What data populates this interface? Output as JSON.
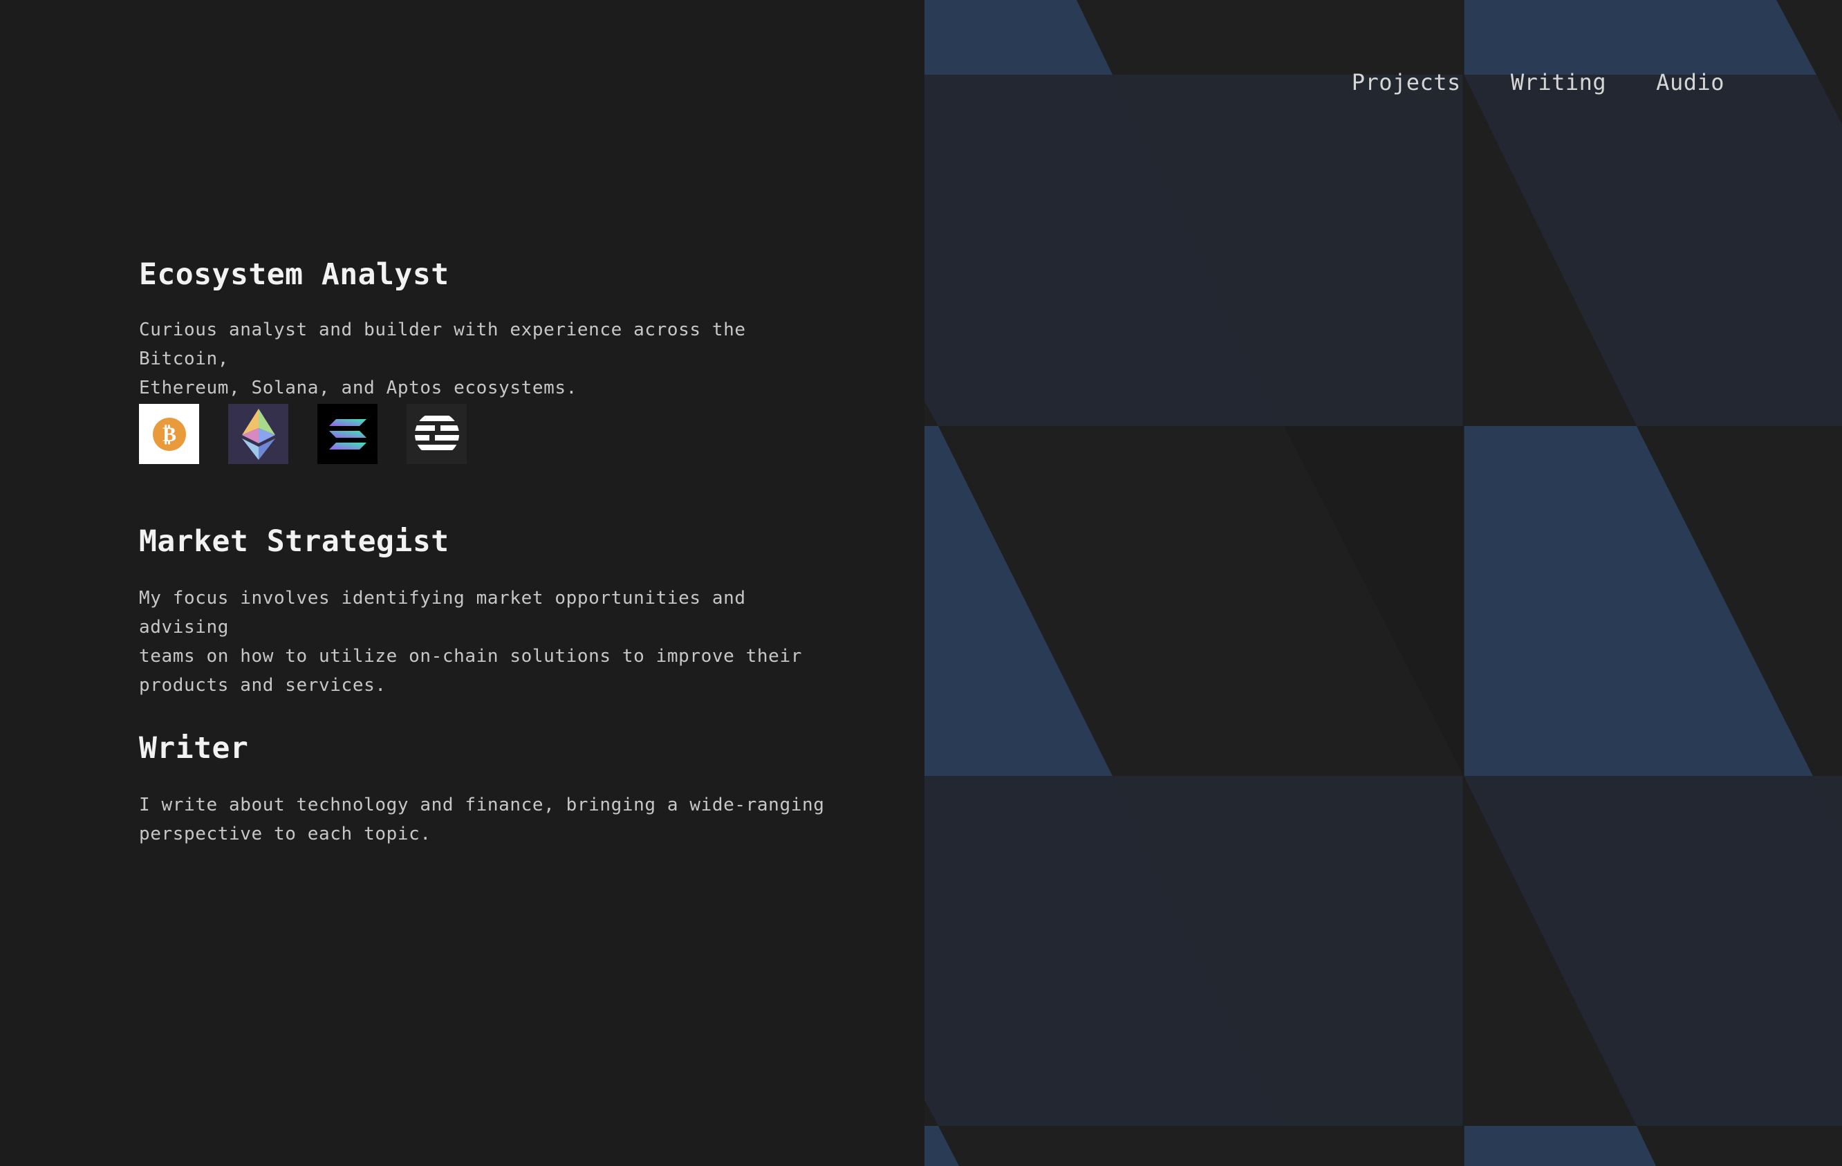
{
  "nav": {
    "items": [
      "Projects",
      "Writing",
      "Audio"
    ]
  },
  "sections": [
    {
      "title": "Ecosystem Analyst",
      "body_line1": "Curious analyst and builder with experience across the Bitcoin,",
      "body_line2": "Ethereum, Solana, and Aptos ecosystems."
    },
    {
      "title": "Market Strategist",
      "body_line1": "My focus involves identifying market opportunities and advising",
      "body_line2": "teams on how to utilize on-chain solutions to improve their",
      "body_line3": "products and services."
    },
    {
      "title": "Writer",
      "body_line1": "I write about technology and finance, bringing a wide-ranging",
      "body_line2": "perspective to each topic."
    }
  ],
  "logos": [
    {
      "icon": "bitcoin-logo-icon",
      "color": "#e99a3a"
    },
    {
      "icon": "ethereum-logo-icon",
      "color": "#8aa4f0"
    },
    {
      "icon": "solana-logo-icon",
      "color": "#9b5ef0"
    },
    {
      "icon": "aptos-logo-icon",
      "color": "#ffffff"
    }
  ],
  "colors": {
    "background": "#1c1c1c",
    "pattern_blue": "#2a3c55",
    "pattern_slate": "#222731",
    "pattern_dark": "#1f1f1f"
  }
}
